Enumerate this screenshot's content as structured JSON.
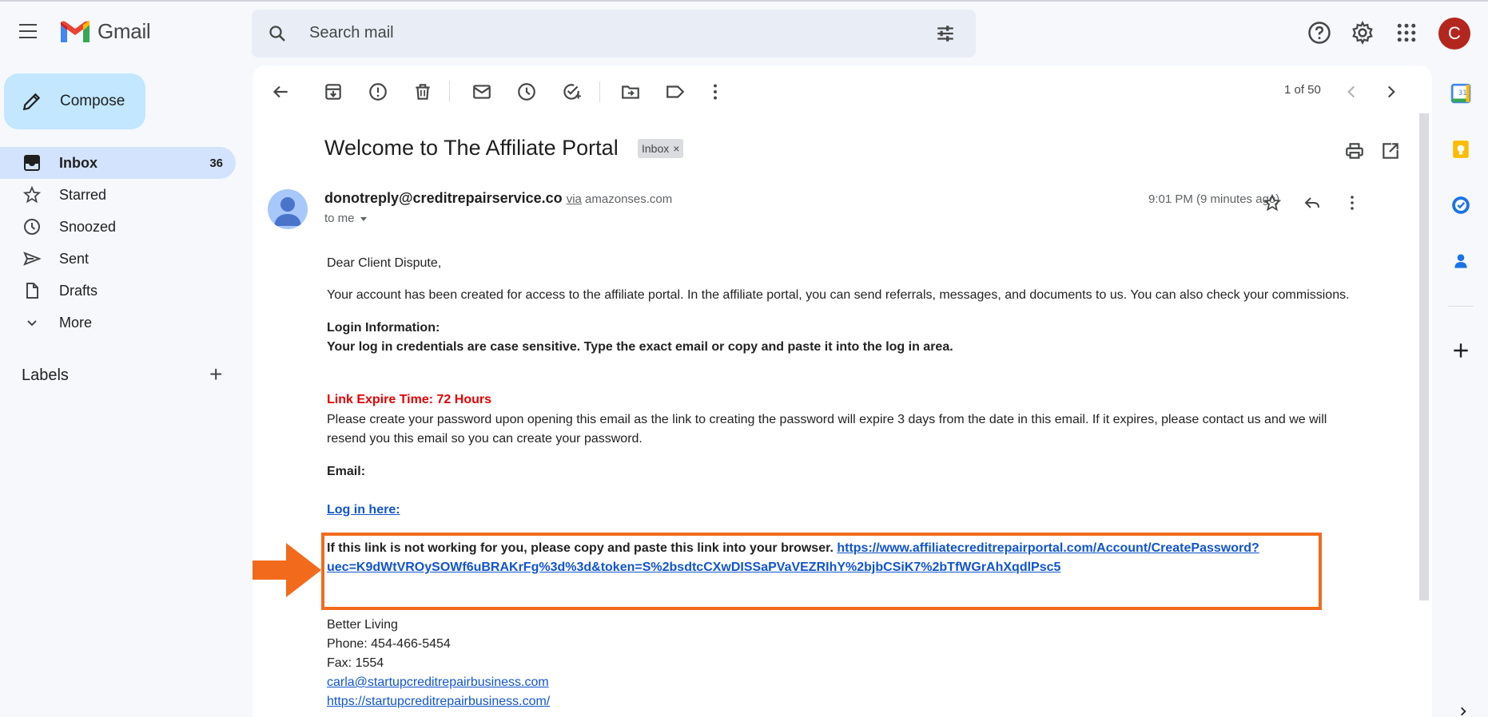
{
  "header": {
    "app_name": "Gmail",
    "search_placeholder": "Search mail",
    "avatar_letter": "C"
  },
  "sidebar": {
    "compose_label": "Compose",
    "items": [
      {
        "label": "Inbox",
        "count": "36"
      },
      {
        "label": "Starred"
      },
      {
        "label": "Snoozed"
      },
      {
        "label": "Sent"
      },
      {
        "label": "Drafts"
      },
      {
        "label": "More"
      }
    ],
    "labels_heading": "Labels"
  },
  "toolbar": {
    "pager": "1 of 50"
  },
  "email": {
    "subject": "Welcome to The Affiliate Portal",
    "label_chip": "Inbox",
    "chip_close": "×",
    "sender_email": "donotreply@creditrepairservice.co",
    "via_word": "via",
    "via_domain": "amazonses.com",
    "to": "to me",
    "time": "9:01 PM (9 minutes ago)",
    "greeting": "Dear Client Dispute,",
    "para1": "Your account has been created for access to the affiliate portal. In the affiliate portal, you can send referrals, messages, and documents to us. You can also check your commissions.",
    "login_heading": "Login Information:",
    "login_note": "Your log in credentials are case sensitive. Type the exact email or copy and paste it into the log in area.",
    "expire_heading": "Link Expire Time: 72 Hours",
    "expire_line1": "Please create your password upon opening this email as the link to creating the password will expire 3 days from the date in this email. If it expires, please contact us and we will",
    "expire_line2": "resend you this email so you can create your password.",
    "email_label": "Email:",
    "login_link": "Log in here:",
    "copy_note": "If this link is not working for you, please copy and paste this link into your browser.",
    "link_part1": "https://www.affiliatecreditrepairportal.com/Account/CreatePassword?",
    "link_part2": "uec=K9dWtVROySOWf6uBRAKrFg%3d%3d&token=S%2bsdtcCXwDISSaPVaVEZRIhY%2bjbCSiK7%2bTfWGrAhXqdlPsc5",
    "signature": {
      "name": "Better Living",
      "phone": "Phone: 454-466-5454",
      "fax": "Fax: 1554",
      "email": "carla@startupcreditrepairbusiness.com",
      "website": "https://startupcreditrepairbusiness.com/"
    }
  },
  "colors": {
    "highlight": "#f26b1d",
    "alert_red": "#e60000",
    "link_blue": "#1155cc",
    "compose_bg": "#c2e7ff",
    "active_nav_bg": "#d3e3fd"
  }
}
